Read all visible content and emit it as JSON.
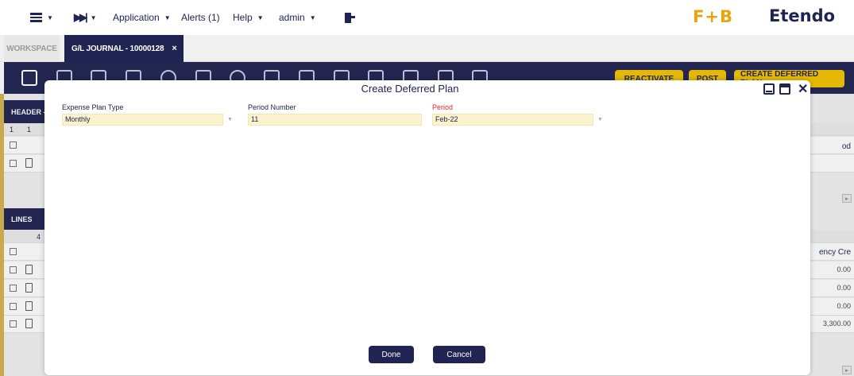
{
  "topbar": {
    "menu_icon": "menu-icon",
    "quick_launch_icon": "skip-forward-icon",
    "application": "Application",
    "alerts": "Alerts (1)",
    "help": "Help",
    "user": "admin",
    "logout_icon": "logout-icon",
    "logo_fb": "F+B",
    "logo_etendo": "Etendo"
  },
  "tabs": {
    "workspace": "WORKSPACE",
    "active": "G/L JOURNAL - 10000128",
    "close": "×"
  },
  "toolbar": {
    "reactivate": "REACTIVATE",
    "post": "POST",
    "create_deferred_plan": "CREATE DEFERRED PLAN"
  },
  "background": {
    "header_label": "HEADER -",
    "header_row_counts": [
      "1",
      "1"
    ],
    "header_col_right": "od",
    "lines_label": "LINES",
    "lines_count": "4",
    "lines_col_right": "ency Cre",
    "line_values": [
      "0.00",
      "0.00",
      "0.00",
      "3,300.00"
    ]
  },
  "modal": {
    "title": "Create Deferred Plan",
    "expense_plan_type_label": "Expense Plan Type",
    "expense_plan_type_value": "Monthly",
    "period_number_label": "Period Number",
    "period_number_value": "11",
    "period_label": "Period",
    "period_value": "Feb-22",
    "done": "Done",
    "cancel": "Cancel"
  },
  "colors": {
    "brand_navy": "#202452",
    "brand_yellow": "#f2c300",
    "required_red": "#e0262a",
    "field_bg": "#fcf3cc"
  }
}
